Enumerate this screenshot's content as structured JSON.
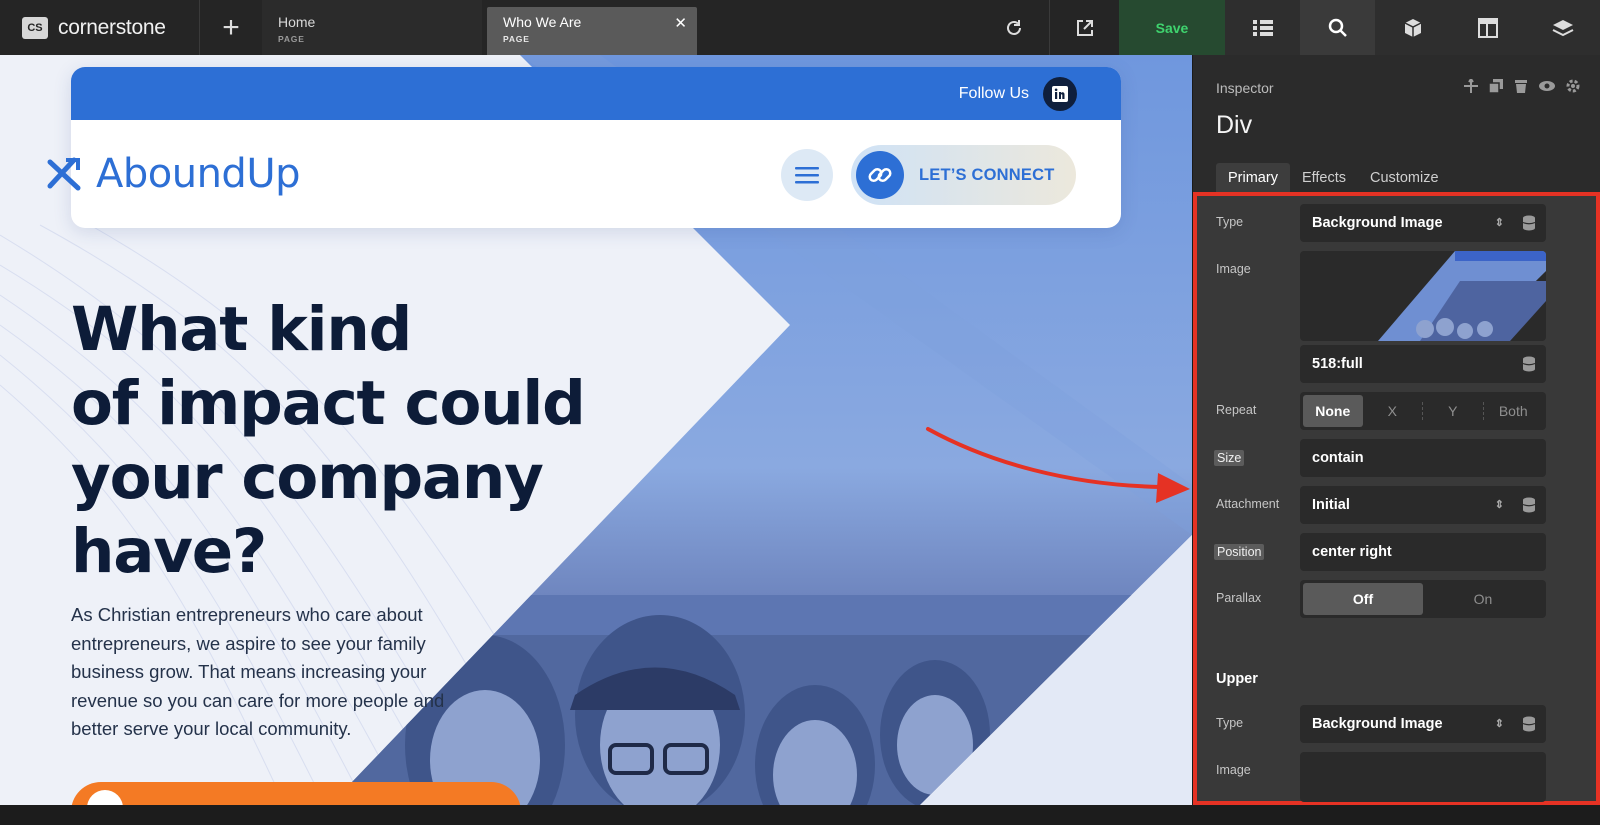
{
  "topbar": {
    "brand_mark": "CS",
    "brand_name": "cornerstone",
    "add_icon": "plus-icon",
    "tabs": [
      {
        "name": "Home",
        "kind": "PAGE"
      },
      {
        "name": "Who We Are",
        "kind": "PAGE"
      }
    ],
    "close_icon": "close-icon",
    "refresh_icon": "refresh-icon",
    "open_icon": "external-link-icon",
    "save_label": "Save",
    "panel_tabs": [
      "list-icon",
      "search-icon",
      "cube-icon",
      "layout-icon",
      "layers-icon"
    ]
  },
  "site": {
    "follow_label": "Follow Us",
    "social_icon": "linkedin-icon",
    "logo_text": "AboundUp",
    "menu_icon": "hamburger-icon",
    "connect_label": "LET’S CONNECT",
    "connect_icon": "link-icon",
    "headline_lines": [
      "What kind",
      "of impact could",
      "your company",
      "have?"
    ],
    "body_lines": [
      "As Christian entrepreneurs who care about",
      "entrepreneurs, we aspire to see your family",
      "business grow. That means increasing your",
      "revenue so you can care for more people and",
      "better serve your local community."
    ]
  },
  "inspector": {
    "title": "Inspector",
    "actions": [
      "move-icon",
      "copy-icon",
      "trash-icon",
      "eye-icon",
      "gear-icon"
    ],
    "element": "Div",
    "tabs": [
      "Primary",
      "Effects",
      "Customize"
    ],
    "rows": {
      "type_label": "Type",
      "type_value": "Background Image",
      "image_label": "Image",
      "image_size_value": "518:full",
      "repeat_label": "Repeat",
      "repeat_options": [
        "None",
        "X",
        "Y",
        "Both"
      ],
      "repeat_selected": "None",
      "size_label": "Size",
      "size_value": "contain",
      "attachment_label": "Attachment",
      "attachment_value": "Initial",
      "position_label": "Position",
      "position_value": "center right",
      "parallax_label": "Parallax",
      "parallax_options": [
        "Off",
        "On"
      ],
      "parallax_selected": "Off"
    },
    "upper": {
      "title": "Upper",
      "type_label": "Type",
      "type_value": "Background Image",
      "image_label": "Image"
    },
    "highlight_color": "#e53224"
  },
  "colors": {
    "accent": "#2d6fd5",
    "headline": "#0d1c38",
    "cta": "#f47a24",
    "save_text": "#3fd36e"
  }
}
